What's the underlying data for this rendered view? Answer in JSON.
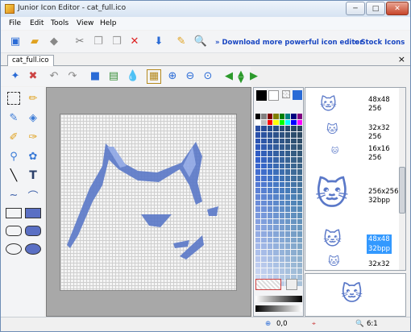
{
  "window": {
    "title": "Junior Icon Editor - cat_full.ico",
    "controls": [
      "minimize",
      "maximize",
      "close"
    ]
  },
  "menu": [
    "File",
    "Edit",
    "Tools",
    "View",
    "Help"
  ],
  "toolbar": {
    "icons": [
      "new-icon",
      "open-icon",
      "save-icon",
      "cut-icon",
      "copy-icon",
      "paste-icon",
      "delete-icon",
      "import-icon",
      "export-icon",
      "search-icon"
    ],
    "links": [
      "» Download more powerful icon editor",
      "» Stock Icons"
    ]
  },
  "document": {
    "tab": "cat_full.ico",
    "close": "×"
  },
  "palette": {
    "colors": [
      "#000000",
      "#808080",
      "#800000",
      "#808000",
      "#008000",
      "#008080",
      "#000080",
      "#800080",
      "#ffffff",
      "#c0c0c0",
      "#ff0000",
      "#ffff00",
      "#00ff00",
      "#00ffff",
      "#0000ff",
      "#ff00ff"
    ]
  },
  "formats": [
    {
      "size": "48x48",
      "bpp": "256"
    },
    {
      "size": "32x32",
      "bpp": "256"
    },
    {
      "size": "16x16",
      "bpp": "256"
    },
    {
      "size": "256x256",
      "bpp": "32bpp"
    },
    {
      "size": "48x48",
      "bpp": "32bpp",
      "selected": true
    },
    {
      "size": "32x32",
      "bpp": ""
    }
  ],
  "status": {
    "coords": "0,0",
    "zoom": "6:1"
  }
}
